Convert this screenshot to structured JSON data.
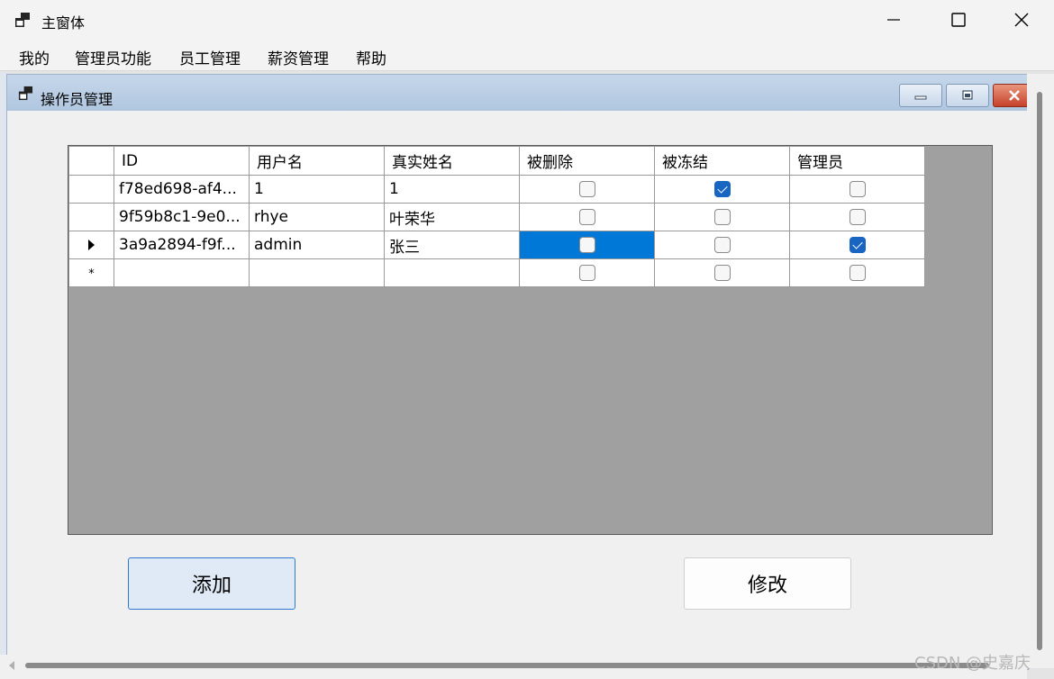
{
  "window": {
    "title": "主窗体"
  },
  "menu": [
    "我的",
    "管理员功能",
    "员工管理",
    "薪资管理",
    "帮助"
  ],
  "child": {
    "title": "操作员管理"
  },
  "grid": {
    "columns": [
      "ID",
      "用户名",
      "真实姓名",
      "被删除",
      "被冻结",
      "管理员"
    ],
    "rows": [
      {
        "id": "f78ed698-af4...",
        "username": "1",
        "realname": "1",
        "deleted": false,
        "frozen": true,
        "admin": false
      },
      {
        "id": "9f59b8c1-9e0...",
        "username": "rhye",
        "realname": "叶荣华",
        "deleted": false,
        "frozen": false,
        "admin": false
      },
      {
        "id": "3a9a2894-f9f...",
        "username": "admin",
        "realname": "张三",
        "deleted": false,
        "frozen": false,
        "admin": true
      }
    ],
    "current_row_indicator": "arrow",
    "new_row_indicator": "*"
  },
  "buttons": {
    "add": "添加",
    "edit": "修改"
  },
  "watermark": "CSDN @史嘉庆",
  "colors": {
    "selection": "#0078d7",
    "checkbox_checked": "#1866c2",
    "grid_background": "#a0a0a0"
  }
}
